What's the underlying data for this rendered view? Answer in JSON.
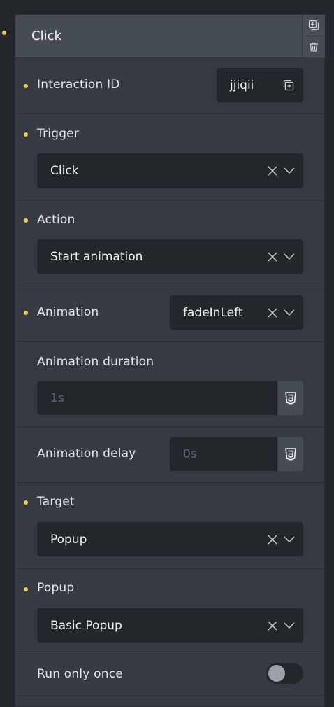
{
  "header": {
    "title": "Click"
  },
  "rows": {
    "interaction_id": {
      "label": "Interaction ID",
      "value": "jjiqii"
    },
    "trigger": {
      "label": "Trigger",
      "value": "Click"
    },
    "action": {
      "label": "Action",
      "value": "Start animation"
    },
    "animation": {
      "label": "Animation",
      "value": "fadeInLeft"
    },
    "animation_duration": {
      "label": "Animation duration",
      "placeholder": "1s"
    },
    "animation_delay": {
      "label": "Animation delay",
      "placeholder": "0s"
    },
    "target": {
      "label": "Target",
      "value": "Popup"
    },
    "popup": {
      "label": "Popup",
      "value": "Basic Popup"
    },
    "run_only_once": {
      "label": "Run only once",
      "checked": false
    }
  },
  "colors": {
    "required_dot": "#f0c94e",
    "panel": "#363b41",
    "field": "#23272b",
    "header": "#454c54"
  }
}
